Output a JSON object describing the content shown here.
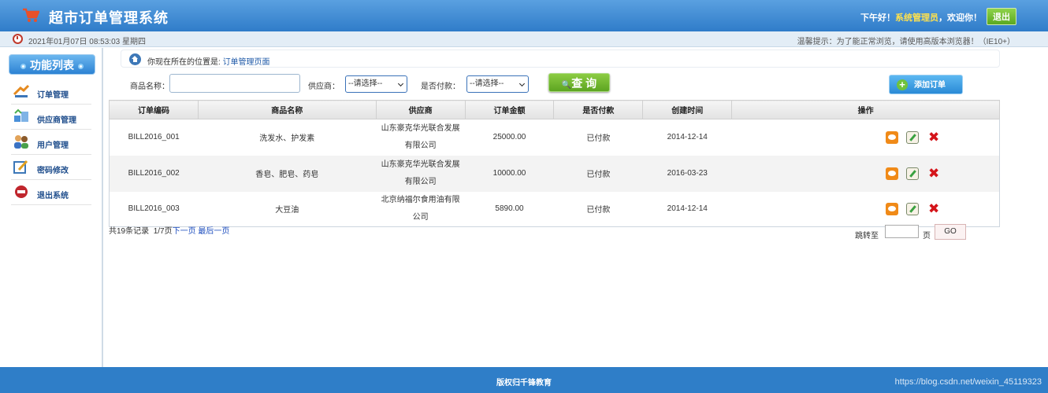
{
  "header": {
    "title": "超市订单管理系统",
    "greeting_prefix": "下午好！",
    "username": "系统管理员",
    "greeting_suffix": "，欢迎你！",
    "logout_label": "退出"
  },
  "subbar": {
    "datetime": "2021年01月07日 08:53:03 星期四",
    "tip": "温馨提示：为了能正常浏览，请使用高版本浏览器！（IE10+）"
  },
  "sidebar": {
    "title": "功能列表",
    "items": [
      {
        "label": "订单管理",
        "icon": "order-icon"
      },
      {
        "label": "供应商管理",
        "icon": "supplier-icon"
      },
      {
        "label": "用户管理",
        "icon": "users-icon"
      },
      {
        "label": "密码修改",
        "icon": "password-icon"
      },
      {
        "label": "退出系统",
        "icon": "exit-icon"
      }
    ]
  },
  "location": {
    "prefix": "你现在所在的位置是:",
    "page": "订单管理页面"
  },
  "search": {
    "product_label": "商品名称：",
    "product_value": "",
    "supplier_label": "供应商：",
    "supplier_value": "--请选择--",
    "paid_label": "是否付款：",
    "paid_value": "--请选择--",
    "query_label": "查 询",
    "add_label": "添加订单"
  },
  "table": {
    "headers": [
      "订单编码",
      "商品名称",
      "供应商",
      "订单金额",
      "是否付款",
      "创建时间",
      "操作"
    ],
    "rows": [
      {
        "code": "BILL2016_001",
        "product": "洗发水、护发素",
        "supplier": "山东豪克华光联合发展有限公司",
        "amount": "25000.00",
        "paid": "已付款",
        "created": "2014-12-14"
      },
      {
        "code": "BILL2016_002",
        "product": "香皂、肥皂、药皂",
        "supplier": "山东豪克华光联合发展有限公司",
        "amount": "10000.00",
        "paid": "已付款",
        "created": "2016-03-23"
      },
      {
        "code": "BILL2016_003",
        "product": "大豆油",
        "supplier": "北京纳福尔食用油有限公司",
        "amount": "5890.00",
        "paid": "已付款",
        "created": "2014-12-14"
      }
    ]
  },
  "pagination": {
    "total": "共19条记录",
    "pages": "1/7页",
    "next": "下一页",
    "last": "最后一页",
    "jump_label": "跳转至",
    "page_unit": "页",
    "go_label": "GO",
    "jump_value": ""
  },
  "footer": {
    "copyright": "版权归千锋教育",
    "watermark": "https://blog.csdn.net/weixin_45119323"
  },
  "colors": {
    "header": "#2f7cc9",
    "greeting_user": "#ffe14d",
    "query_button": "#5da521",
    "add_button": "#2a8ad6",
    "delete": "#d4141a"
  }
}
